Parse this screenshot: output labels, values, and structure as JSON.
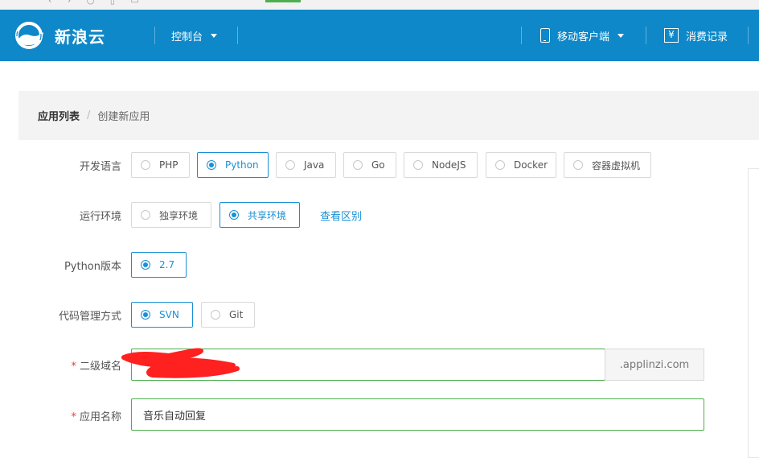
{
  "brand": {
    "name": "新浪云"
  },
  "nav": {
    "console": "控制台",
    "mobile": "移动客户端",
    "billing": "消费记录"
  },
  "breadcrumb": {
    "root": "应用列表",
    "separator": "/",
    "current": "创建新应用"
  },
  "form": {
    "language": {
      "label": "开发语言",
      "options": [
        "PHP",
        "Python",
        "Java",
        "Go",
        "NodeJS",
        "Docker",
        "容器虚拟机"
      ],
      "selected": "Python"
    },
    "environment": {
      "label": "运行环境",
      "options": [
        "独享环境",
        "共享环境"
      ],
      "selected": "共享环境",
      "diff_link": "查看区别"
    },
    "python_version": {
      "label": "Python版本",
      "options": [
        "2.7"
      ],
      "selected": "2.7"
    },
    "vcs": {
      "label": "代码管理方式",
      "options": [
        "SVN",
        "Git"
      ],
      "selected": "SVN"
    },
    "subdomain": {
      "required_mark": "*",
      "label": "二级域名",
      "value": "",
      "suffix": ".applinzi.com"
    },
    "app_name": {
      "required_mark": "*",
      "label": "应用名称",
      "value": "音乐自动回复"
    }
  },
  "colors": {
    "topbar": "#0e88c8",
    "accent": "#1890d6",
    "valid_border": "#4cae4c",
    "redaction": "#ff2020"
  },
  "icons": {
    "logo": "cloud-logo-icon",
    "mobile": "phone-icon",
    "billing": "yen-icon",
    "dropdown": "caret-down-icon"
  }
}
